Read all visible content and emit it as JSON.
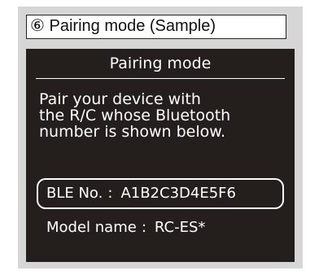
{
  "caption": {
    "number": "⑥",
    "text": "Pairing mode (Sample)"
  },
  "screen": {
    "title": "Pairing mode",
    "message_lines": [
      "Pair your device with",
      "the R/C whose Bluetooth",
      "number is shown below."
    ],
    "ble": {
      "label": "BLE No.",
      "separator": ":",
      "value": "A1B2C3D4E5F6"
    },
    "model": {
      "label": "Model name",
      "separator": ":",
      "value": "RC-ES*"
    }
  },
  "colors": {
    "screen_background": "#241f1d",
    "screen_text": "#ffffff",
    "panel_background": "#d6d6d6"
  }
}
